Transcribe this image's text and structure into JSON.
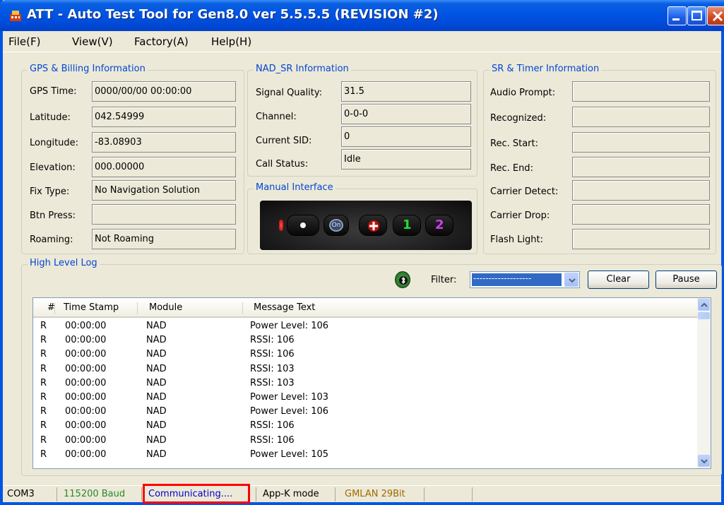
{
  "window": {
    "title": "ATT - Auto Test Tool for Gen8.0 ver 5.5.5.5 (REVISION #2)"
  },
  "menu": [
    {
      "label": "File(F)"
    },
    {
      "label": "View(V)"
    },
    {
      "label": "Factory(A)"
    },
    {
      "label": "Help(H)"
    }
  ],
  "gps": {
    "legend": "GPS & Billing Information",
    "fields": [
      {
        "label": "GPS Time:",
        "value": "0000/00/00 00:00:00"
      },
      {
        "label": "Latitude:",
        "value": "042.54999"
      },
      {
        "label": "Longitude:",
        "value": "-83.08903"
      },
      {
        "label": "Elevation:",
        "value": "000.00000"
      },
      {
        "label": "Fix Type:",
        "value": "No Navigation Solution"
      },
      {
        "label": "Btn Press:",
        "value": ""
      },
      {
        "label": "Roaming:",
        "value": "Not Roaming"
      }
    ]
  },
  "nad": {
    "legend": "NAD_SR Information",
    "fields": [
      {
        "label": "Signal Quality:",
        "value": "31.5"
      },
      {
        "label": "Channel:",
        "value": "0-0-0"
      },
      {
        "label": "Current SID:",
        "value": "0"
      },
      {
        "label": "Call Status:",
        "value": "Idle"
      }
    ]
  },
  "manual": {
    "legend": "Manual Interface",
    "buttons": [
      "dot",
      "on-star",
      "emergency",
      "1",
      "2"
    ]
  },
  "sr": {
    "legend": "SR & Timer Information",
    "fields": [
      {
        "label": "Audio Prompt:",
        "value": ""
      },
      {
        "label": "Recognized:",
        "value": ""
      },
      {
        "label": "Rec. Start:",
        "value": ""
      },
      {
        "label": "Rec. End:",
        "value": ""
      },
      {
        "label": "Carrier Detect:",
        "value": ""
      },
      {
        "label": "Carrier Drop:",
        "value": ""
      },
      {
        "label": "Flash Light:",
        "value": ""
      }
    ]
  },
  "log": {
    "legend": "High Level Log",
    "filter_label": "Filter:",
    "filter_value": "-------------------",
    "clear_label": "Clear",
    "pause_label": "Pause",
    "columns": [
      "#",
      "Time Stamp",
      "Module",
      "Message Text"
    ],
    "rows": [
      {
        "n": "R",
        "time": "00:00:00",
        "module": "NAD",
        "msg": "Power Level: 106"
      },
      {
        "n": "R",
        "time": "00:00:00",
        "module": "NAD",
        "msg": "RSSI: 106"
      },
      {
        "n": "R",
        "time": "00:00:00",
        "module": "NAD",
        "msg": "RSSI: 106"
      },
      {
        "n": "R",
        "time": "00:00:00",
        "module": "NAD",
        "msg": "RSSI: 103"
      },
      {
        "n": "R",
        "time": "00:00:00",
        "module": "NAD",
        "msg": "RSSI: 103"
      },
      {
        "n": "R",
        "time": "00:00:00",
        "module": "NAD",
        "msg": "Power Level: 103"
      },
      {
        "n": "R",
        "time": "00:00:00",
        "module": "NAD",
        "msg": "Power Level: 106"
      },
      {
        "n": "R",
        "time": "00:00:00",
        "module": "NAD",
        "msg": "RSSI: 106"
      },
      {
        "n": "R",
        "time": "00:00:00",
        "module": "NAD",
        "msg": "RSSI: 106"
      },
      {
        "n": "R",
        "time": "00:00:00",
        "module": "NAD",
        "msg": "Power Level: 105"
      }
    ]
  },
  "status": {
    "port": "COM3",
    "baud": "115200 Baud",
    "state": "Communicating....",
    "mode": "App-K mode",
    "bus": "GMLAN 29Bit"
  },
  "colors": {
    "accent": "#0046d5",
    "titlebar": "#0054e3",
    "status_baud": "#2a8a2a",
    "status_state": "#0000cc",
    "status_bus": "#a06a00",
    "highlight_box": "#ff0000"
  }
}
